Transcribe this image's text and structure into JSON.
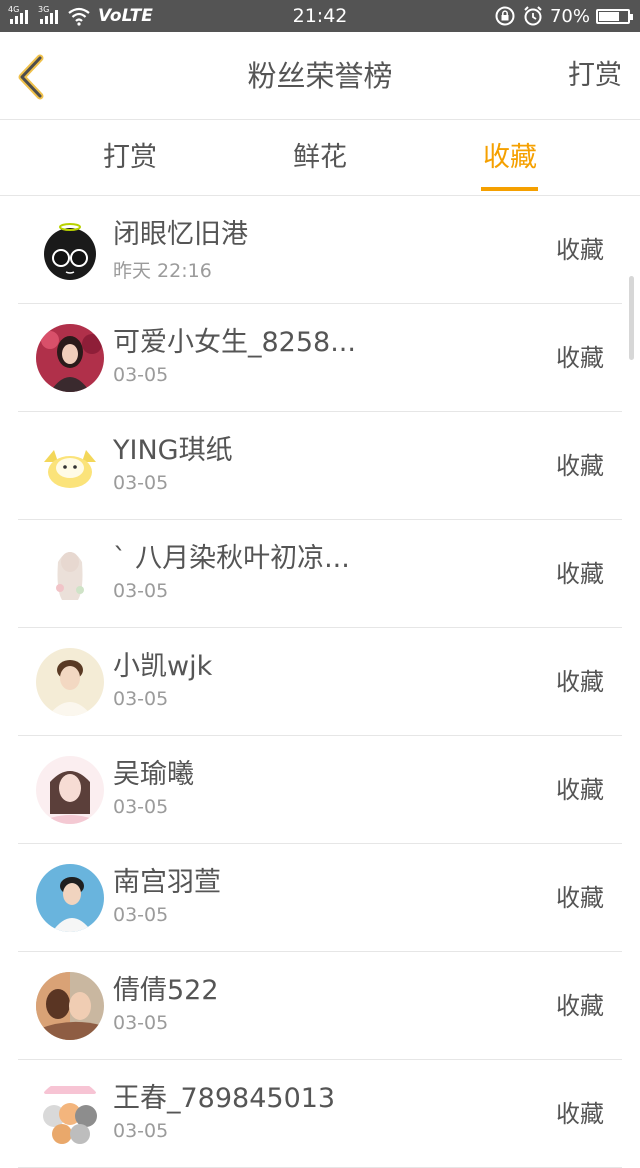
{
  "status_bar": {
    "net1": "4G",
    "net2": "3G",
    "volte": "VoLTE",
    "time": "21:42",
    "battery_text": "70%",
    "battery_level": 0.7
  },
  "header": {
    "title": "粉丝荣誉榜",
    "action_label": "打赏"
  },
  "tabs": [
    {
      "label": "打赏",
      "active": false
    },
    {
      "label": "鲜花",
      "active": false
    },
    {
      "label": "收藏",
      "active": true
    }
  ],
  "accent_color": "#f5a000",
  "items": [
    {
      "name": "闭眼忆旧港",
      "date": "昨天 22:16",
      "action": "收藏"
    },
    {
      "name": "可爱小女生_8258...",
      "date": "03-05",
      "action": "收藏"
    },
    {
      "name": "YING琪纸",
      "date": "03-05",
      "action": "收藏"
    },
    {
      "name": "ˋ 八月染秋叶初凉...",
      "date": "03-05",
      "action": "收藏"
    },
    {
      "name": "小凯wjk",
      "date": "03-05",
      "action": "收藏"
    },
    {
      "name": "吴瑜曦",
      "date": "03-05",
      "action": "收藏"
    },
    {
      "name": "南宫羽萱",
      "date": "03-05",
      "action": "收藏"
    },
    {
      "name": "倩倩522",
      "date": "03-05",
      "action": "收藏"
    },
    {
      "name": "王春_789845013",
      "date": "03-05",
      "action": "收藏"
    }
  ]
}
